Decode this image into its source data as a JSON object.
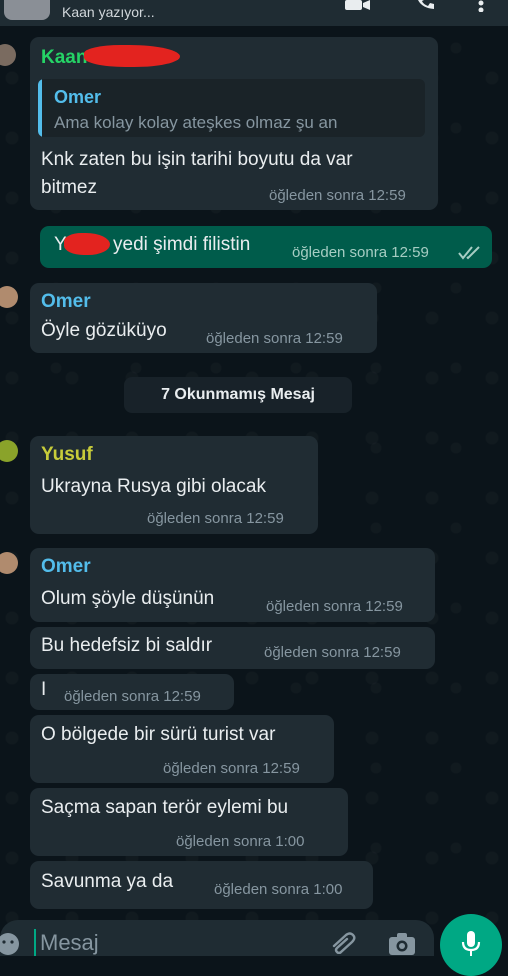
{
  "header": {
    "status": "Kaan yazıyor..."
  },
  "messages": {
    "m1": {
      "sender": "Kaan",
      "quote_name": "Omer",
      "quote_text": "Ama kolay kolay ateşkes olmaz şu an",
      "line1": "Knk zaten bu işin tarihi boyutu da var",
      "line2": "bitmez",
      "time": "öğleden sonra 12:59"
    },
    "m2": {
      "text_start": "Y",
      "text_end": "yedi şimdi filistin",
      "time": "öğleden sonra 12:59"
    },
    "m3": {
      "sender": "Omer",
      "text": "Öyle gözüküyo",
      "time": "öğleden sonra 12:59"
    },
    "unread": "7 Okunmamış Mesaj",
    "m4": {
      "sender": "Yusuf",
      "text": "Ukrayna Rusya gibi olacak",
      "time": "öğleden sonra 12:59"
    },
    "m5": {
      "sender": "Omer",
      "text": "Olum şöyle düşünün",
      "time": "öğleden sonra 12:59"
    },
    "m6": {
      "text": "Bu hedefsiz bi saldır",
      "time": "öğleden sonra 12:59"
    },
    "m7": {
      "text": "I",
      "time": "öğleden sonra 12:59"
    },
    "m8": {
      "text": "O bölgede bir sürü turist var",
      "time": "öğleden sonra 12:59"
    },
    "m9": {
      "text": "Saçma sapan terör eylemi bu",
      "time": "öğleden sonra 1:00"
    },
    "m10": {
      "text": "Savunma ya da",
      "time": "öğleden sonra 1:00"
    }
  },
  "composer": {
    "placeholder": "Mesaj"
  },
  "colors": {
    "background": "#0b141a",
    "incoming_bubble": "#202c33",
    "outgoing_bubble": "#005c4b",
    "sender_kaan": "#25d366",
    "sender_omer": "#53bdeb",
    "sender_yusuf": "#c7cc3a",
    "accent": "#00a884"
  },
  "icons": [
    "video-call-icon",
    "phone-icon",
    "more-options-icon",
    "emoji-icon",
    "attach-icon",
    "camera-icon",
    "mic-icon",
    "read-receipt-icon"
  ]
}
